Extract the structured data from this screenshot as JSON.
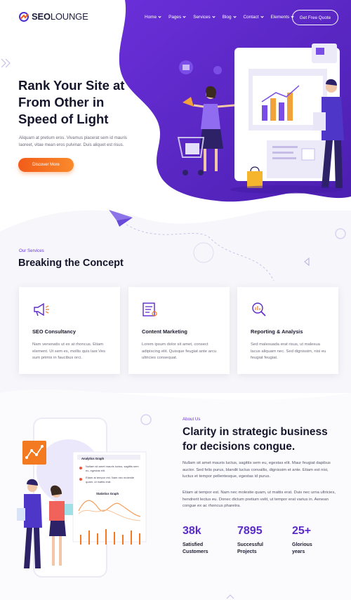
{
  "brand": {
    "name_bold": "SEO",
    "name_light": "LOUNGE"
  },
  "nav": {
    "items": [
      {
        "label": "Home"
      },
      {
        "label": "Pages"
      },
      {
        "label": "Services"
      },
      {
        "label": "Blog"
      },
      {
        "label": "Contact"
      },
      {
        "label": "Elements"
      }
    ],
    "cta": "Get Free Quote"
  },
  "hero": {
    "title": "Rank Your Site at From Other in Speed of Light",
    "text": "Aliquam at pretium eros. Vivamus placerat sem id mauris laoreet, vitae mean eros pulvinar. Duis aliquet est risus.",
    "button": "Discover More"
  },
  "services": {
    "eyebrow": "Our Services",
    "title": "Breaking the Concept",
    "cards": [
      {
        "icon": "megaphone-icon",
        "title": "SEO Consultancy",
        "text": "Nam venenatis ut ex at rhoncus. Etiam element. Ut sem ex, mollis quis laor.Ves sum primis in faucibus orci."
      },
      {
        "icon": "document-icon",
        "title": "Content Marketing",
        "text": "Lorem ipsum dolor sit amet, consect adipiscing elit. Quisque feugiat ante arcu ultricies consequat."
      },
      {
        "icon": "magnifier-chart-icon",
        "title": "Reporting & Analysis",
        "text": "Sed malesuada erat risus, ut malesua lacus aliquam nec. Sed dignissim, nisi eu feugiat feugiat."
      }
    ]
  },
  "about": {
    "eyebrow": "About Us",
    "title": "Clarity in strategic business for decisions congue.",
    "p1": "Nullam sit amet mauris luctus, sagittis sem eu, egestas elit. Maur feugiat dapibus auctor. Sed felis purus, blandit luctus convallis, dignissim et ante. Etiam est nisi, luctus et tempor pellentesque, egestas id purus.",
    "p2": "Etiam at tempor est. Nam nec molestie quam, ut mattis erat. Duis nec urna ultricies, hendrerit lectus eu. Donec dictum pretium velit, ut tempor erat varius in. Aenean congue ex ac rhoncus pharetra.",
    "illustration": {
      "analytics_title": "Analytics Graph",
      "analytics_line1": "Nullam sit amet mauris luctus, sagittis sem eu, egestas elit.",
      "analytics_line2": "Etiam at tempor est. Nam nec molestie quam, ut mattis erat.",
      "statistics_title": "Statistics Graph"
    },
    "stats": [
      {
        "number": "38k",
        "label": "Satisfied Customers"
      },
      {
        "number": "7895",
        "label": "Successful Projects"
      },
      {
        "number": "25+",
        "label": "Glorious years"
      }
    ]
  },
  "colors": {
    "primary": "#5b2bc9",
    "accent": "#f47a22",
    "dark": "#15152b"
  }
}
